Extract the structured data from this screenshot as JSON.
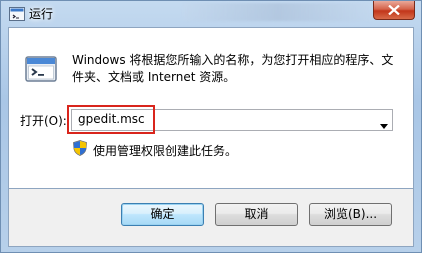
{
  "window": {
    "title": "运行"
  },
  "dialog": {
    "description": "Windows 将根据您所输入的名称，为您打开相应的程序、文件夹、文档或 Internet 资源。",
    "open_label": "打开(O):",
    "input_value": "gpedit.msc",
    "admin_note": "使用管理权限创建此任务。"
  },
  "buttons": {
    "ok": "确定",
    "cancel": "取消",
    "browse": "浏览(B)..."
  },
  "colors": {
    "highlight_border": "#d9251c",
    "close_button": "#c2361a"
  }
}
